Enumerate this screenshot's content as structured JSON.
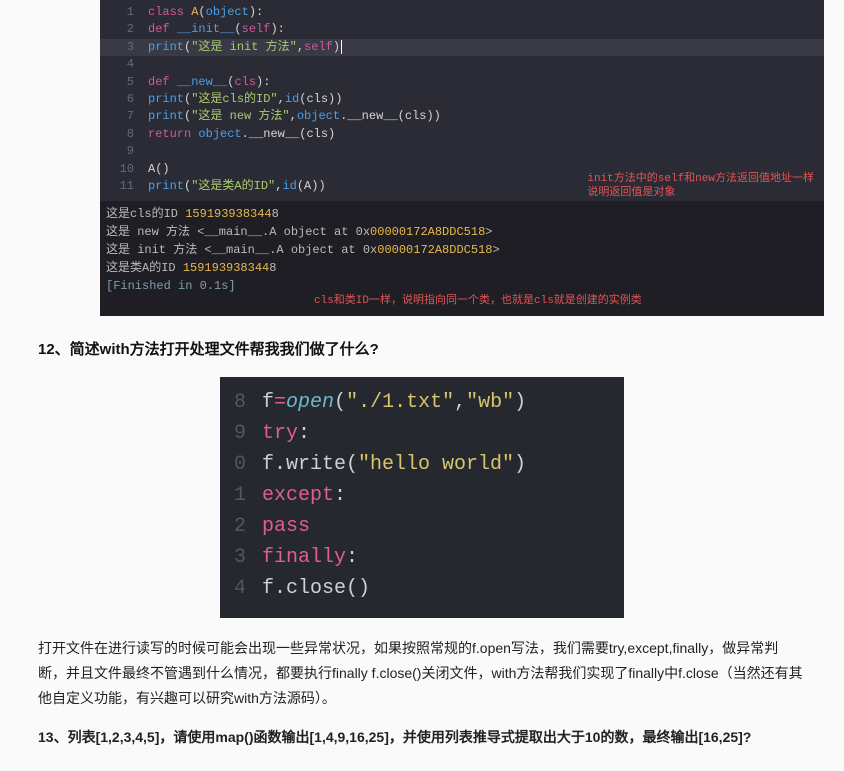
{
  "code1": {
    "lines": [
      {
        "n": "1",
        "segs": [
          {
            "c": "kw",
            "t": "class "
          },
          {
            "c": "cls",
            "t": "A"
          },
          {
            "c": "plain",
            "t": "("
          },
          {
            "c": "builtin",
            "t": "object"
          },
          {
            "c": "plain",
            "t": "):"
          }
        ]
      },
      {
        "n": "2",
        "segs": [
          {
            "c": "plain",
            "t": "    "
          },
          {
            "c": "kw",
            "t": "def "
          },
          {
            "c": "fn",
            "t": "__init__"
          },
          {
            "c": "plain",
            "t": "("
          },
          {
            "c": "self",
            "t": "self"
          },
          {
            "c": "plain",
            "t": "):"
          }
        ]
      },
      {
        "n": "3",
        "hl": true,
        "segs": [
          {
            "c": "plain",
            "t": "        "
          },
          {
            "c": "builtin",
            "t": "print"
          },
          {
            "c": "plain",
            "t": "("
          },
          {
            "c": "str",
            "t": "\"这是 init 方法\""
          },
          {
            "c": "plain",
            "t": ","
          },
          {
            "c": "self",
            "t": "self"
          },
          {
            "c": "plain",
            "t": ")"
          }
        ],
        "cursor": true
      },
      {
        "n": "4",
        "segs": []
      },
      {
        "n": "5",
        "segs": [
          {
            "c": "plain",
            "t": "    "
          },
          {
            "c": "kw",
            "t": "def "
          },
          {
            "c": "fn",
            "t": "__new__"
          },
          {
            "c": "plain",
            "t": "("
          },
          {
            "c": "self",
            "t": "cls"
          },
          {
            "c": "plain",
            "t": "):"
          }
        ]
      },
      {
        "n": "6",
        "segs": [
          {
            "c": "plain",
            "t": "        "
          },
          {
            "c": "builtin",
            "t": "print"
          },
          {
            "c": "plain",
            "t": "("
          },
          {
            "c": "str",
            "t": "\"这是cls的ID\""
          },
          {
            "c": "plain",
            "t": ","
          },
          {
            "c": "builtin",
            "t": "id"
          },
          {
            "c": "plain",
            "t": "(cls))"
          }
        ]
      },
      {
        "n": "7",
        "segs": [
          {
            "c": "plain",
            "t": "        "
          },
          {
            "c": "builtin",
            "t": "print"
          },
          {
            "c": "plain",
            "t": "("
          },
          {
            "c": "str",
            "t": "\"这是 new 方法\""
          },
          {
            "c": "plain",
            "t": ","
          },
          {
            "c": "builtin",
            "t": "object"
          },
          {
            "c": "plain",
            "t": ".__new__(cls))"
          }
        ]
      },
      {
        "n": "8",
        "segs": [
          {
            "c": "plain",
            "t": "        "
          },
          {
            "c": "kw",
            "t": "return "
          },
          {
            "c": "builtin",
            "t": "object"
          },
          {
            "c": "plain",
            "t": ".__new__(cls)"
          }
        ]
      },
      {
        "n": "9",
        "segs": []
      },
      {
        "n": "10",
        "segs": [
          {
            "c": "plain",
            "t": "A()"
          }
        ]
      },
      {
        "n": "11",
        "segs": [
          {
            "c": "builtin",
            "t": "print"
          },
          {
            "c": "plain",
            "t": "("
          },
          {
            "c": "str",
            "t": "\"这是类A的ID\""
          },
          {
            "c": "plain",
            "t": ","
          },
          {
            "c": "builtin",
            "t": "id"
          },
          {
            "c": "plain",
            "t": "(A))"
          }
        ]
      }
    ]
  },
  "output": {
    "anno_right_1": "init方法中的self和new方法返回值地址一样",
    "anno_right_2": "说明返回值是对象",
    "anno_bottom": "cls和类ID一样，说明指向同一个类，也就是cls就是创建的实例类",
    "lines": [
      {
        "pre": "这是cls的ID ",
        "num": "159193938344",
        "post": "8"
      },
      {
        "pre": "这是 new 方法 <__main__.A object at 0x",
        "hex": "00000172A8DDC518",
        "post2": ">"
      },
      {
        "pre": "这是 init 方法 <__main__.A object at 0x",
        "hex": "00000172A8DDC518",
        "post2": ">"
      },
      {
        "pre": "这是类A的ID ",
        "num": "159193938344",
        "post": "8"
      }
    ],
    "finished": "[Finished in 0.1s]"
  },
  "q12_title": "12、简述with方法打开处理文件帮我我们做了什么?",
  "code2": {
    "lines": [
      {
        "n": "8",
        "segs": [
          {
            "c": "p2",
            "t": "f"
          },
          {
            "c": "kw2",
            "t": "="
          },
          {
            "c": "fn2",
            "t": "open"
          },
          {
            "c": "p2",
            "t": "("
          },
          {
            "c": "str2",
            "t": "\"./1.txt\""
          },
          {
            "c": "p2",
            "t": ","
          },
          {
            "c": "str2",
            "t": "\"wb\""
          },
          {
            "c": "p2",
            "t": ")"
          }
        ]
      },
      {
        "n": "9",
        "segs": [
          {
            "c": "kw2",
            "t": "try"
          },
          {
            "c": "p2",
            "t": ":"
          }
        ]
      },
      {
        "n": "0",
        "segs": [
          {
            "c": "p2",
            "t": "    f.write("
          },
          {
            "c": "str2",
            "t": "\"hello world\""
          },
          {
            "c": "p2",
            "t": ")"
          }
        ]
      },
      {
        "n": "1",
        "segs": [
          {
            "c": "kw2",
            "t": "except"
          },
          {
            "c": "p2",
            "t": ":"
          }
        ]
      },
      {
        "n": "2",
        "segs": [
          {
            "c": "p2",
            "t": "    "
          },
          {
            "c": "kw2",
            "t": "pass"
          }
        ]
      },
      {
        "n": "3",
        "segs": [
          {
            "c": "kw2",
            "t": "finally"
          },
          {
            "c": "p2",
            "t": ":"
          }
        ]
      },
      {
        "n": "4",
        "segs": [
          {
            "c": "p2",
            "t": "    f.close()"
          }
        ]
      }
    ]
  },
  "q12_body": "打开文件在进行读写的时候可能会出现一些异常状况，如果按照常规的f.open写法，我们需要try,except,finally，做异常判断，并且文件最终不管遇到什么情况，都要执行finally f.close()关闭文件，with方法帮我们实现了finally中f.close（当然还有其他自定义功能，有兴趣可以研究with方法源码）。",
  "q13_title": "13、列表[1,2,3,4,5]，请使用map()函数输出[1,4,9,16,25]，并使用列表推导式提取出大于10的数，最终输出[16,25]?"
}
